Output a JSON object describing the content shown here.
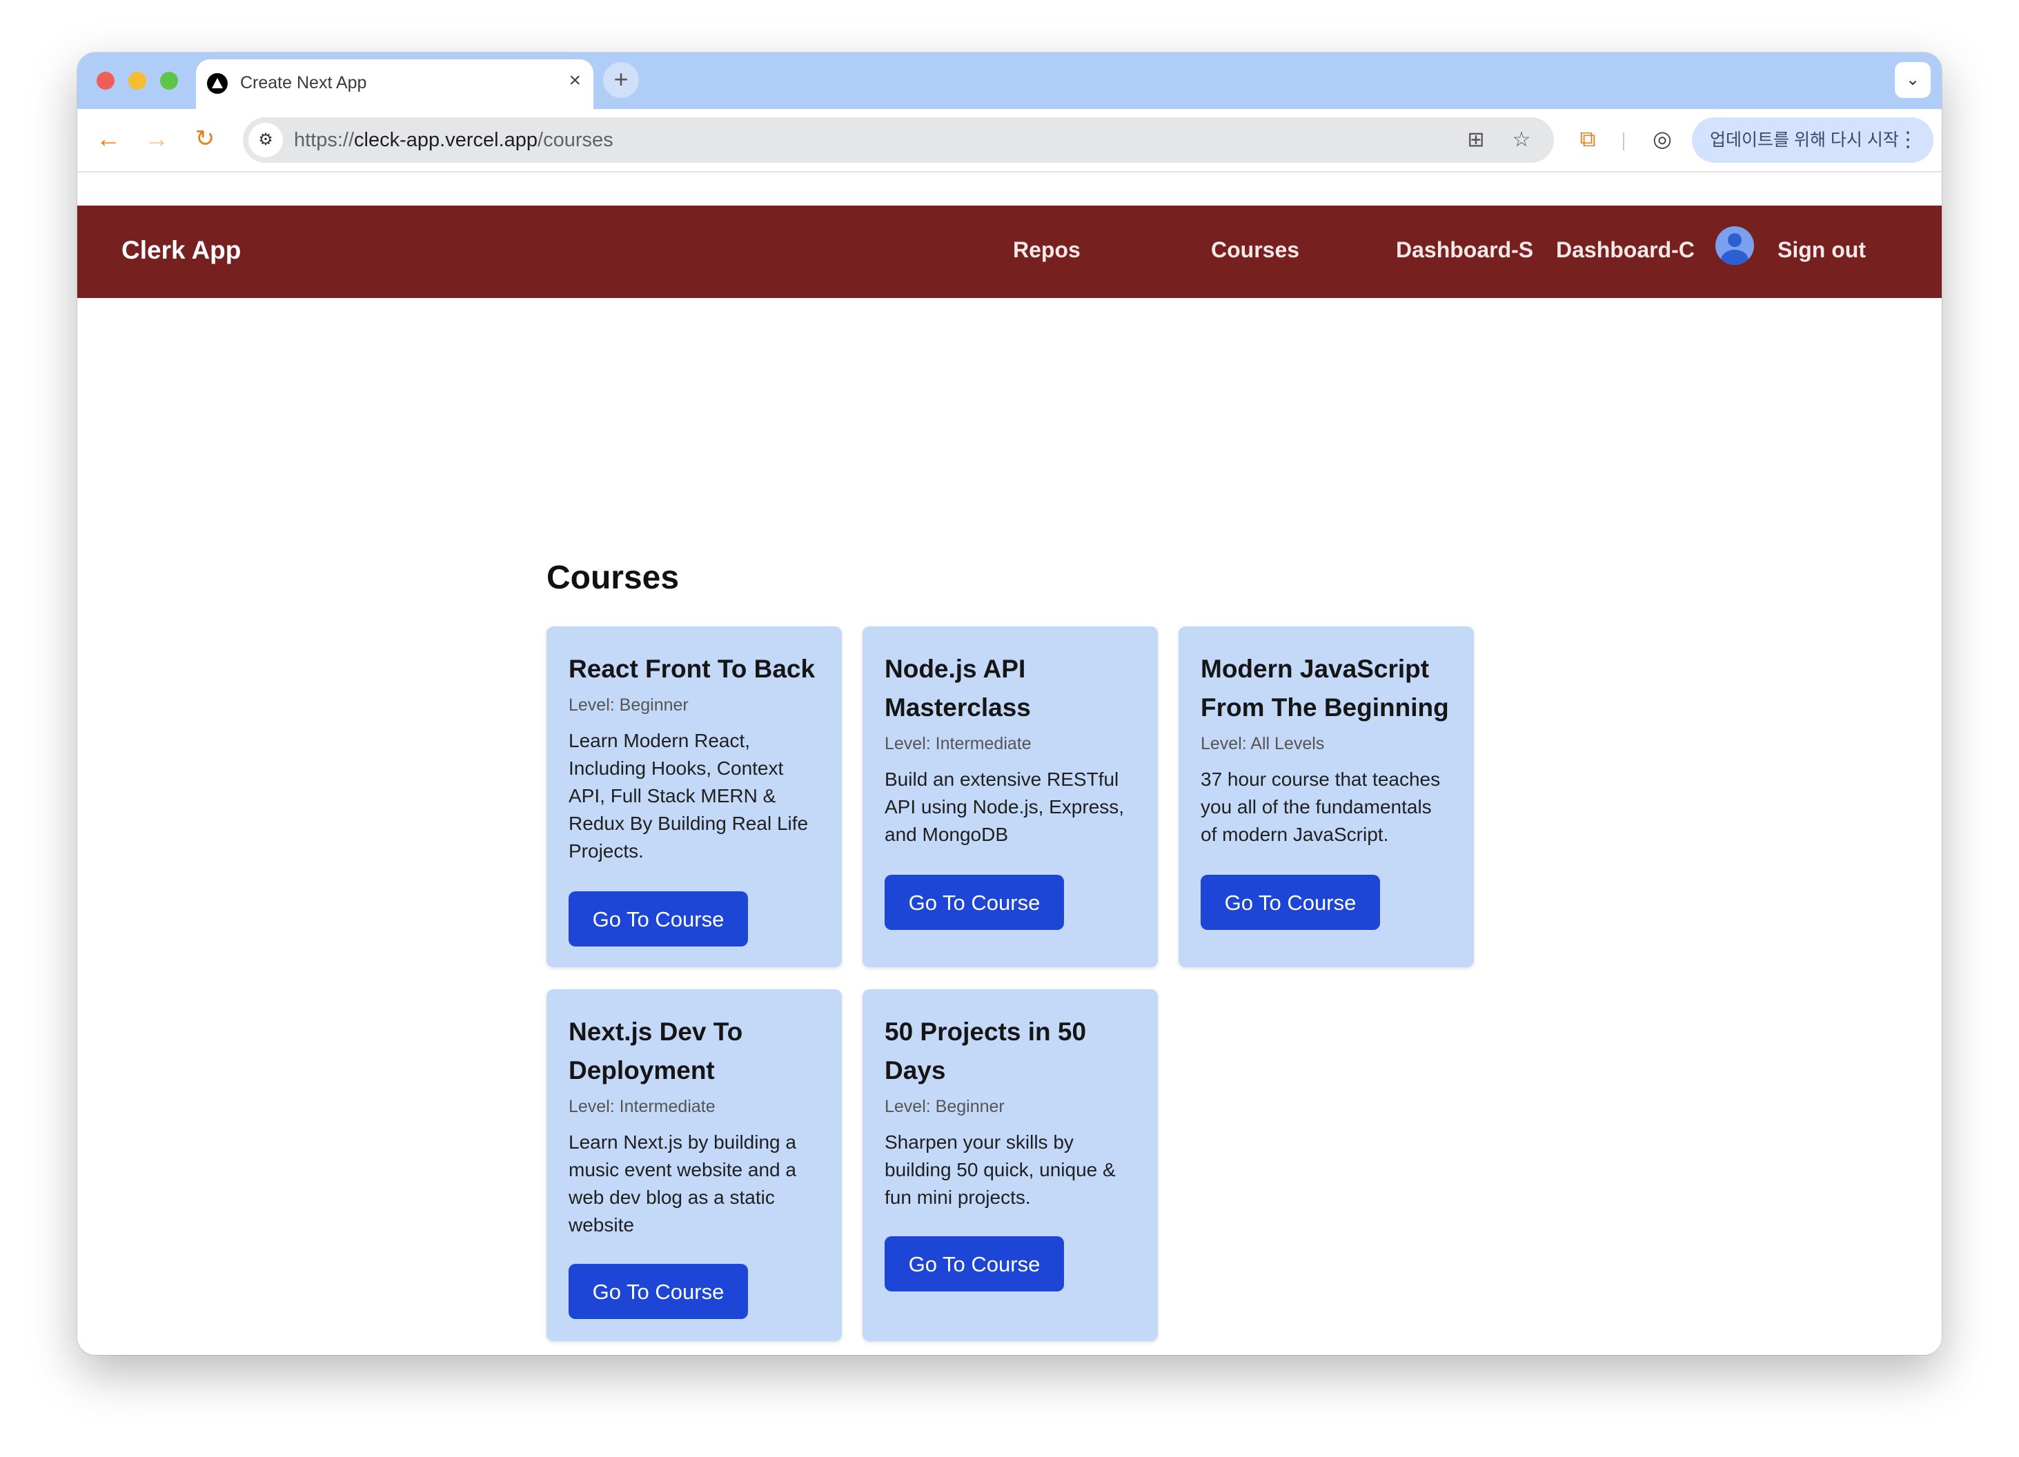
{
  "browser": {
    "tab_title": "Create Next App",
    "tab_close": "×",
    "new_tab": "+",
    "tab_menu": "⌄",
    "url_scheme": "https://",
    "url_host": "cleck-app.vercel.app",
    "url_path": "/courses",
    "update_label": "업데이트를 위해 다시 시작",
    "update_menu": "⋮",
    "icons": {
      "back": "←",
      "forward": "→",
      "reload": "↻",
      "site_info": "⚙",
      "translate": "⊞",
      "star": "☆",
      "extensions": "⧉",
      "profile": "◎"
    }
  },
  "nav": {
    "brand": "Clerk App",
    "links": [
      "Repos",
      "Courses",
      "Dashboard-S",
      "Dashboard-C"
    ],
    "sign_out": "Sign out"
  },
  "main": {
    "heading": "Courses",
    "courses": [
      {
        "title": "React Front To Back",
        "level": "Level: Beginner",
        "description": "Learn Modern React, Including Hooks, Context API, Full Stack MERN & Redux By Building Real Life Projects.",
        "button": "Go To Course"
      },
      {
        "title": "Node.js API Masterclass",
        "level": "Level: Intermediate",
        "description": "Build an extensive RESTful API using Node.js, Express, and MongoDB",
        "button": "Go To Course"
      },
      {
        "title": "Modern JavaScript From The Beginning",
        "level": "Level: All Levels",
        "description": "37 hour course that teaches you all of the fundamentals of modern JavaScript.",
        "button": "Go To Course"
      },
      {
        "title": "Next.js Dev To Deployment",
        "level": "Level: Intermediate",
        "description": "Learn Next.js by building a music event website and a web dev blog as a static website",
        "button": "Go To Course"
      },
      {
        "title": "50 Projects in 50 Days",
        "level": "Level: Beginner",
        "description": "Sharpen your skills by building 50 quick, unique & fun mini projects.",
        "button": "Go To Course"
      }
    ]
  },
  "colors": {
    "nav_bg": "#76201f",
    "card_bg": "#c4d9f8",
    "button_bg": "#1e46d6",
    "tabstrip_bg": "#afcdf6"
  }
}
